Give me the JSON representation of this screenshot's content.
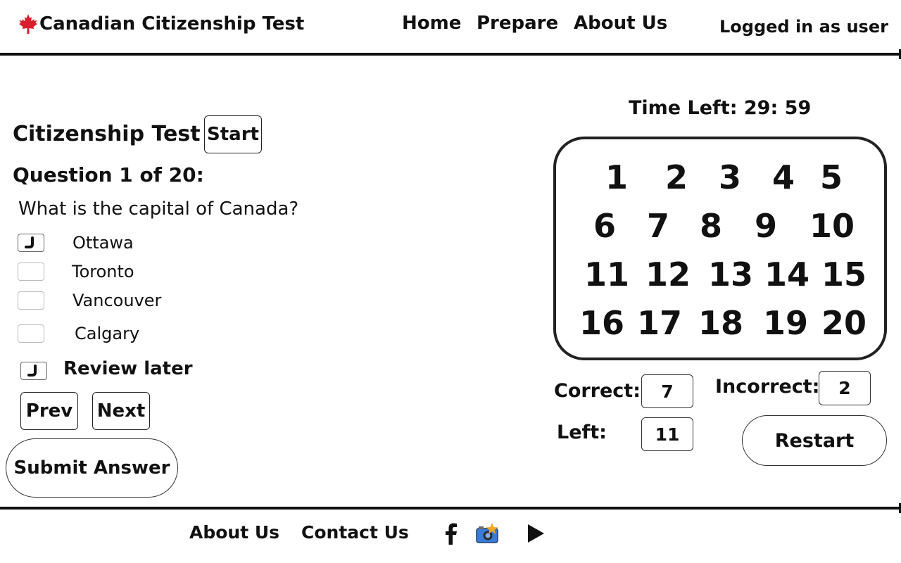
{
  "header": {
    "brand_title": "Canadian Citizenship Test",
    "brand_icon": "maple-leaf-icon",
    "nav": {
      "home": "Home",
      "prepare": "Prepare",
      "about": "About Us"
    },
    "user_status": "Logged in as user"
  },
  "test": {
    "title": "Citizenship Test",
    "start_label": "Start",
    "question_number": "Question 1 of 20:",
    "question_text": "What is the capital of Canada?",
    "options": [
      {
        "label": "Ottawa",
        "checked": true
      },
      {
        "label": "Toronto",
        "checked": false
      },
      {
        "label": "Vancouver",
        "checked": false
      },
      {
        "label": "Calgary",
        "checked": false
      }
    ],
    "review_label": "Review later",
    "review_checked": true,
    "prev_label": "Prev",
    "next_label": "Next",
    "submit_label": "Submit Answer"
  },
  "sidebar": {
    "timer": "Time Left: 29: 59",
    "question_numbers": [
      "1",
      "2",
      "3",
      "4",
      "5",
      "6",
      "7",
      "8",
      "9",
      "10",
      "11",
      "12",
      "13",
      "14",
      "15",
      "16",
      "17",
      "18",
      "19",
      "20"
    ],
    "correct_label": "Correct:",
    "correct_value": "7",
    "incorrect_label": "Incorrect:",
    "incorrect_value": "2",
    "left_label": "Left:",
    "left_value": "11",
    "restart_label": "Restart"
  },
  "footer": {
    "about": "About Us",
    "contact": "Contact Us",
    "social_icons": [
      "facebook-icon",
      "camera-icon",
      "play-icon"
    ]
  },
  "colors": {
    "leaf": "#d81e2c",
    "line": "#111111",
    "camera_body": "#3a7bd5",
    "camera_flash": "#f5a623"
  }
}
